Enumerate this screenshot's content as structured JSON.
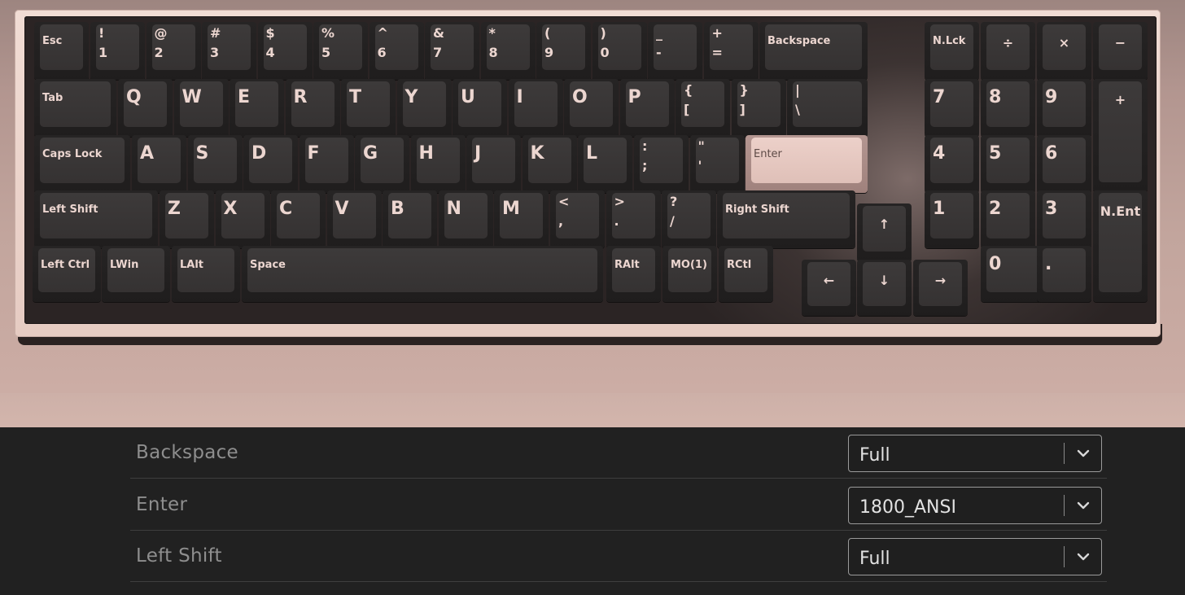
{
  "keyboard": {
    "row1": [
      "Esc",
      "1",
      "2",
      "3",
      "4",
      "5",
      "6",
      "7",
      "8",
      "9",
      "0",
      "-",
      "=",
      "Backspace",
      "N.Lck",
      "÷",
      "×",
      "−"
    ],
    "row1_shift": [
      "!",
      "@",
      "#",
      "$",
      "%",
      "^",
      "&",
      "*",
      "(",
      ")",
      "_",
      "+"
    ],
    "row2": [
      "Tab",
      "Q",
      "W",
      "E",
      "R",
      "T",
      "Y",
      "U",
      "I",
      "O",
      "P",
      "[",
      "]",
      "\\",
      "7",
      "8",
      "9",
      "+"
    ],
    "row2_shift": [
      "{",
      "}",
      "|"
    ],
    "row3": [
      "Caps Lock",
      "A",
      "S",
      "D",
      "F",
      "G",
      "H",
      "J",
      "K",
      "L",
      ";",
      "'",
      "Enter",
      "4",
      "5",
      "6"
    ],
    "row3_shift": [
      ":",
      "\""
    ],
    "row4": [
      "Left Shift",
      "Z",
      "X",
      "C",
      "V",
      "B",
      "N",
      "M",
      ",",
      ".",
      "/",
      "Right Shift",
      "↑",
      "1",
      "2",
      "3",
      "N.Ent"
    ],
    "row4_shift": [
      "<",
      ">",
      "?"
    ],
    "row5": [
      "Left Ctrl",
      "LWin",
      "LAlt",
      "Space",
      "RAlt",
      "MO(1)",
      "RCtl",
      "←",
      "↓",
      "→",
      "0",
      "."
    ]
  },
  "settings": [
    {
      "label": "Backspace",
      "value": "Full"
    },
    {
      "label": "Enter",
      "value": "1800_ANSI"
    },
    {
      "label": "Left Shift",
      "value": "Full"
    }
  ],
  "colors": {
    "case": "#eed8d0",
    "plate": "#2b2424",
    "keycap": "#3a3737",
    "legend": "#ecd6d0",
    "accent_key": "#e8ccc4",
    "panel_bg": "#212121"
  }
}
